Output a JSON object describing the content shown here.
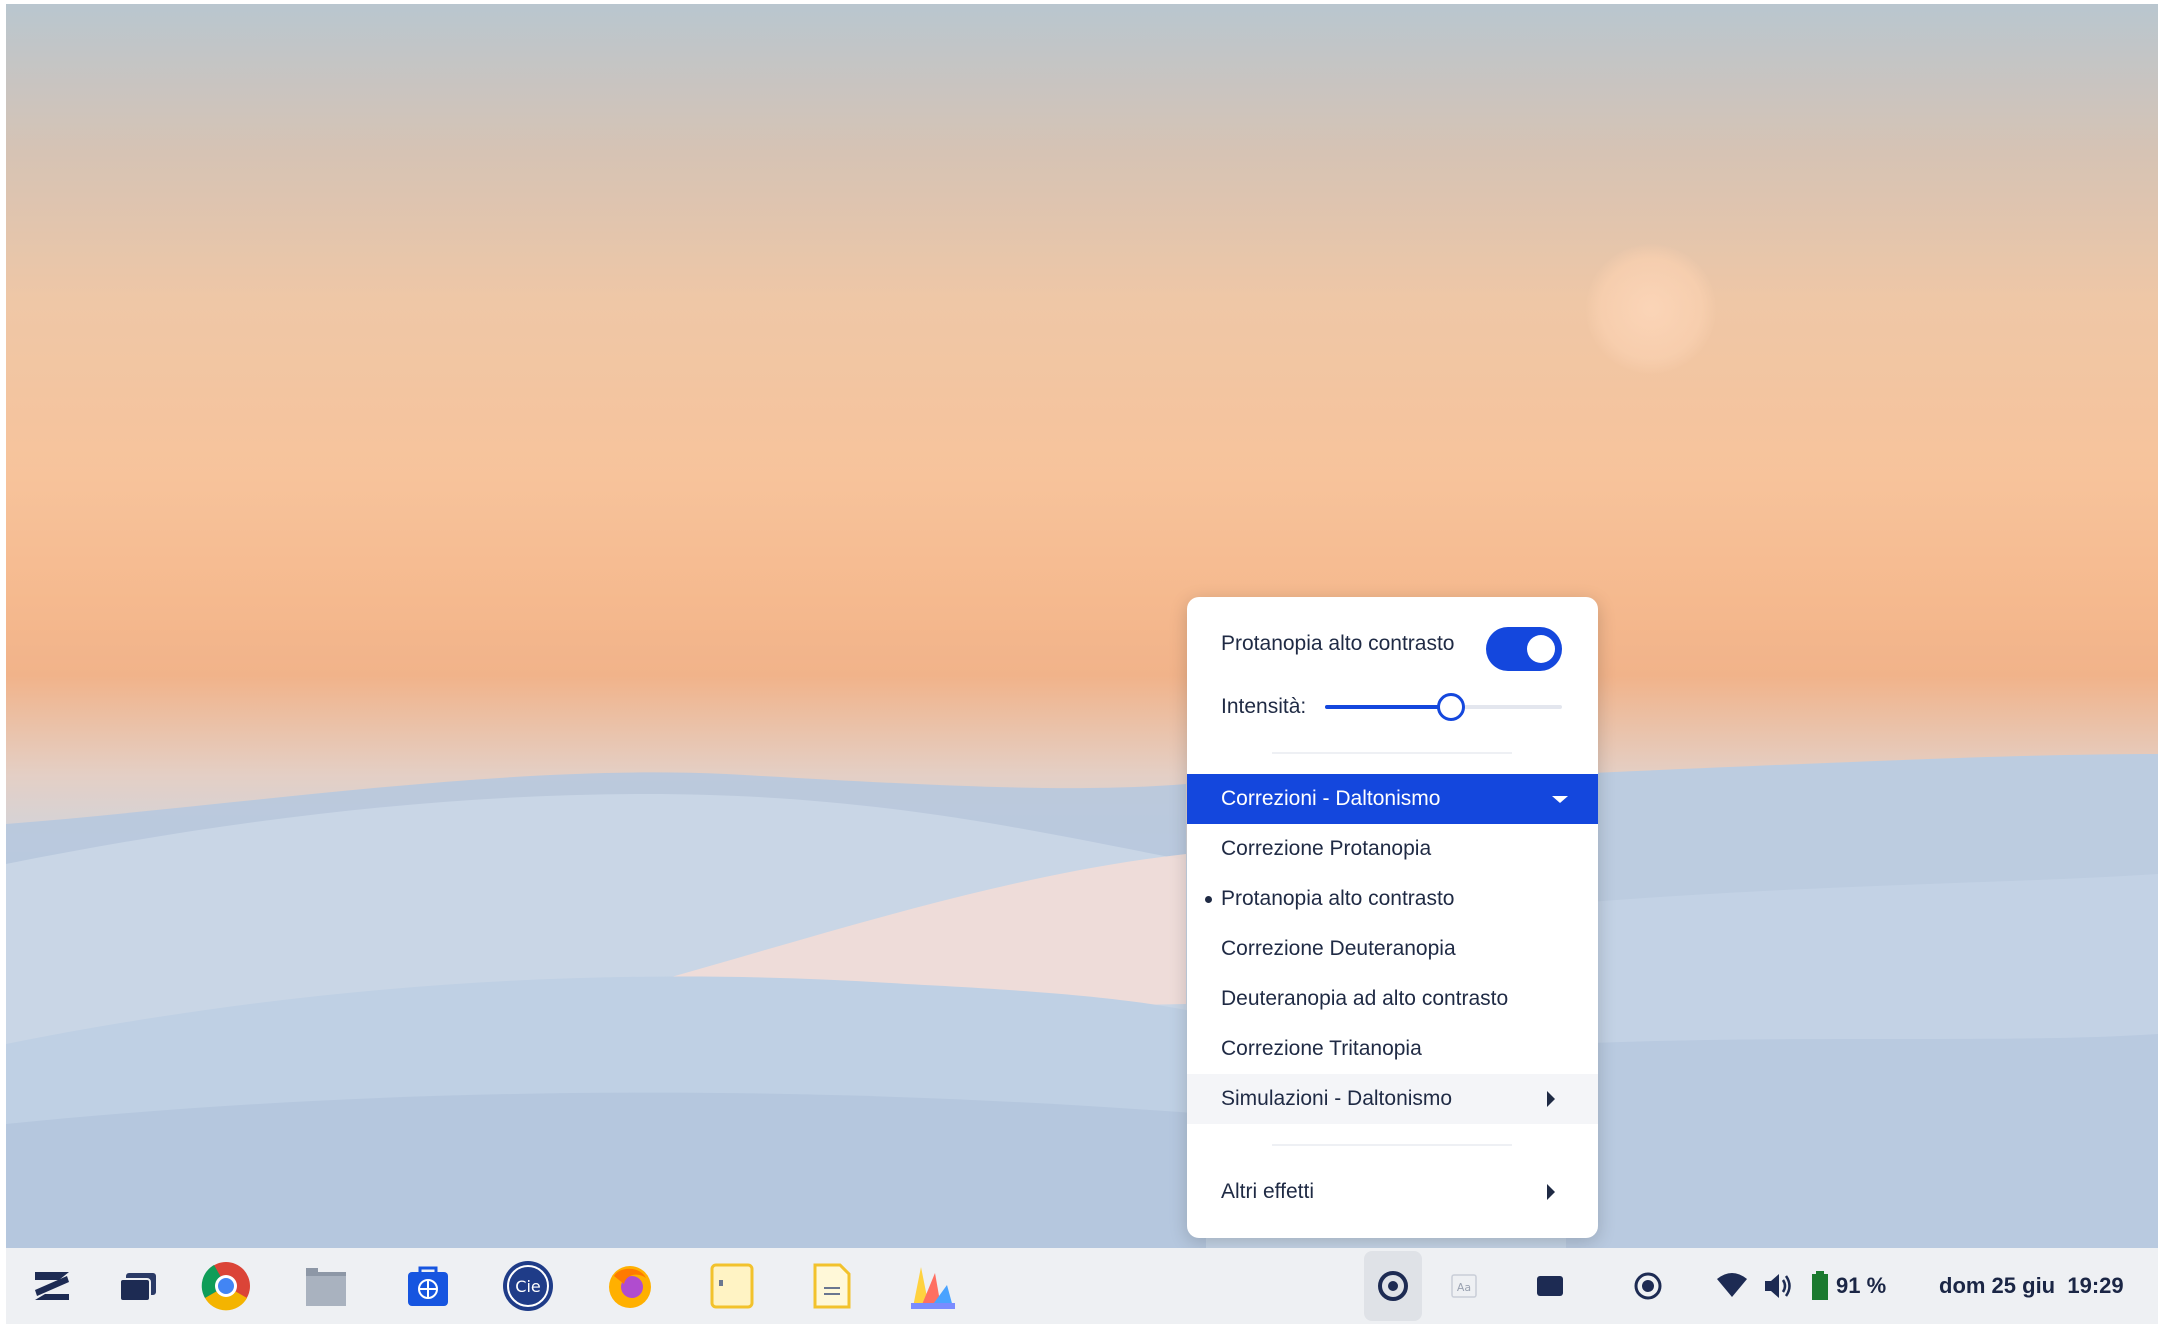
{
  "popup": {
    "toggle_label": "Protanopia alto contrasto",
    "toggle_on": true,
    "intensity_label": "Intensità:",
    "intensity_value": 0.53,
    "corrections_header": "Correzioni - Daltonismo",
    "options": [
      {
        "label": "Correzione Protanopia",
        "selected": false
      },
      {
        "label": "Protanopia alto contrasto",
        "selected": true
      },
      {
        "label": "Correzione Deuteranopia",
        "selected": false
      },
      {
        "label": "Deuteranopia ad alto contrasto",
        "selected": false
      },
      {
        "label": "Correzione Tritanopia",
        "selected": false
      }
    ],
    "simulations_label": "Simulazioni - Daltonismo",
    "other_effects_label": "Altri effetti"
  },
  "taskbar": {
    "apps": [
      "zorin-menu-icon",
      "window-overview-icon",
      "chrome-icon",
      "files-icon",
      "software-store-icon",
      "cieid-icon",
      "firefox-icon",
      "text-editor-icon",
      "document-viewer-icon",
      "color-app-icon"
    ],
    "tray_icons": [
      "screen-filter-icon",
      "font-aa-icon",
      "display-icon",
      "record-icon",
      "wifi-icon",
      "volume-icon",
      "battery-icon"
    ],
    "battery": "91 %",
    "clock": "dom 25 giu  19:29"
  },
  "colors": {
    "accent": "#1447dd",
    "text": "#1f2a44",
    "taskbar": "#eef0f3"
  }
}
